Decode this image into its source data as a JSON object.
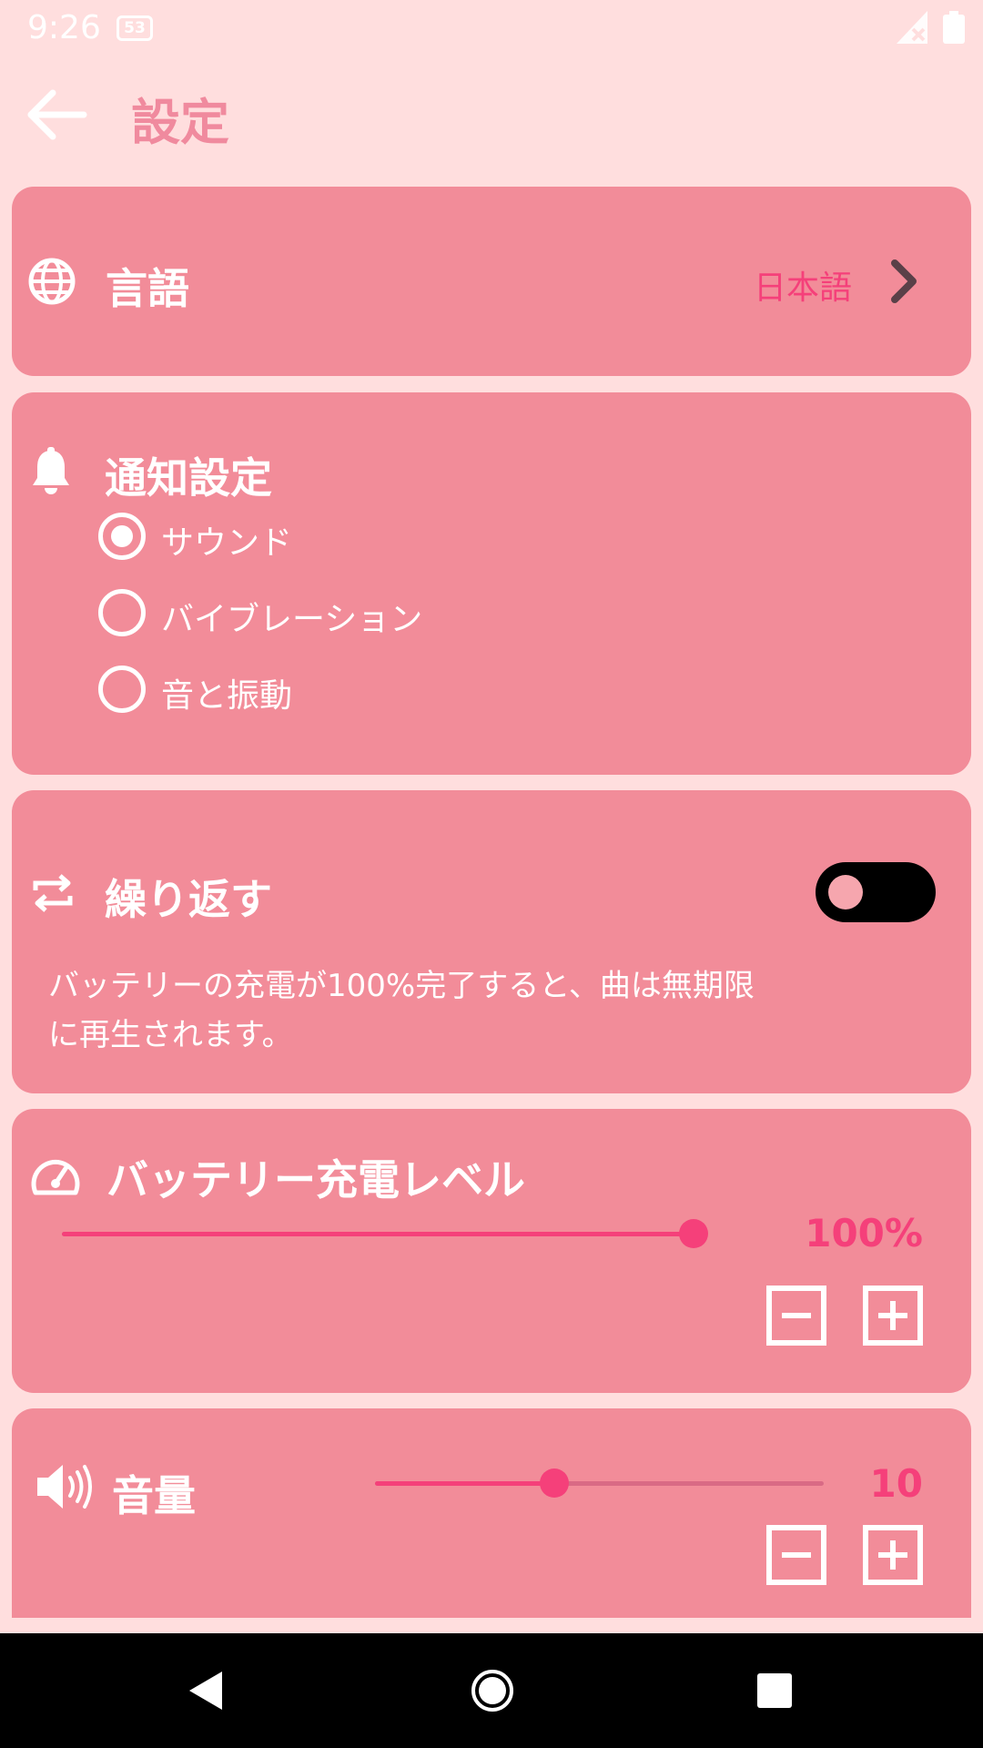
{
  "status_bar": {
    "time": "9:26",
    "badge": "53"
  },
  "app_bar": {
    "title": "設定"
  },
  "language": {
    "label": "言語",
    "value": "日本語"
  },
  "notification": {
    "title": "通知設定",
    "options": [
      {
        "label": "サウンド",
        "checked": true
      },
      {
        "label": "バイブレーション",
        "checked": false
      },
      {
        "label": "音と振動",
        "checked": false
      }
    ]
  },
  "repeat": {
    "title": "繰り返す",
    "enabled": false,
    "description_line1": "バッテリーの充電が100%完了すると、曲は無期限",
    "description_line2": "に再生されます。"
  },
  "battery_level": {
    "title": "バッテリー充電レベル",
    "value_label": "100%",
    "slider_fraction": 1.0
  },
  "volume": {
    "title": "音量",
    "value_label": "10",
    "slider_fraction": 0.4
  },
  "colors": {
    "background": "#FFDEDE",
    "card": "#F28C99",
    "accent": "#F5407A",
    "title": "#F08A9E"
  }
}
